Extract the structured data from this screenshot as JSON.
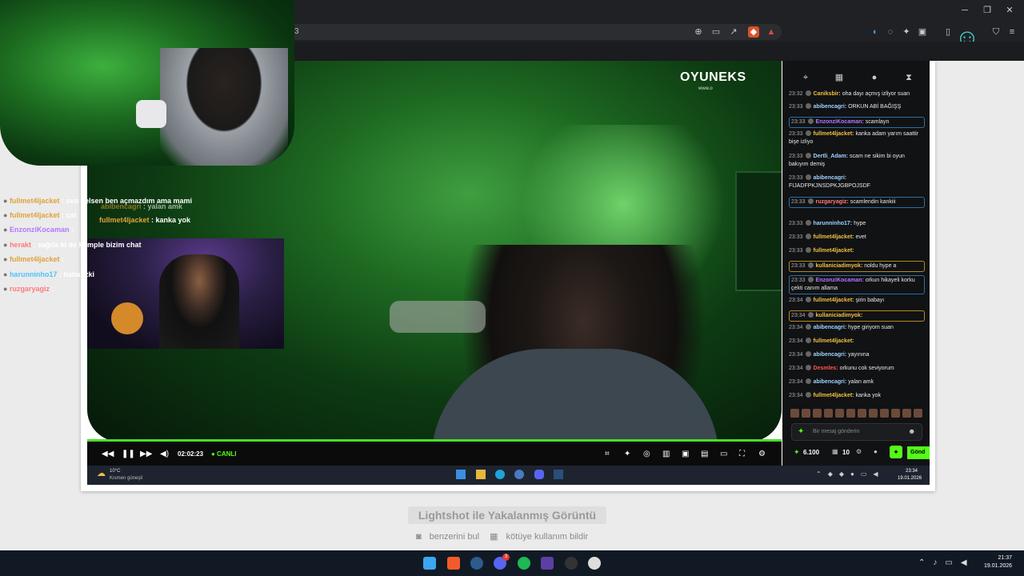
{
  "browser": {
    "url_fragment": "3",
    "controls": {
      "minimize": "─",
      "maximize": "❐",
      "close": "✕"
    }
  },
  "video": {
    "logo": "OYUNEKS",
    "logo_sub": "www.o",
    "time": "02:02:23",
    "live_label": "● CANLI"
  },
  "chat": {
    "messages": [
      {
        "time": "23:32",
        "user": "Caniksbir",
        "text": "oha dayı açmış izliyor suan",
        "style": ""
      },
      {
        "time": "23:33",
        "user": "abibencagri",
        "text": "ORKUN ABİ BAĞIŞŞ",
        "style": ""
      },
      {
        "time": "23:33",
        "user": "EnzonziKocaman",
        "text": "scamlayn",
        "style": "hl"
      },
      {
        "time": "23:33",
        "user": "fullmet4ljacket",
        "text": "kanka adam yarım saattir bişe izliyo",
        "style": ""
      },
      {
        "time": "23:33",
        "user": "Dertli_Adam",
        "text": "scam ne sikim bi oyun bakıyım demiş",
        "style": ""
      },
      {
        "time": "23:33",
        "user": "abibencagri",
        "text": "FIJADFPKJNSDPKJGBPOJSDF",
        "style": ""
      },
      {
        "time": "23:33",
        "user": "ruzgaryagiz",
        "text": "scamlendin kankiii",
        "style": "hl"
      },
      {
        "time": "23:33",
        "user": "harunninho17",
        "text": "hype",
        "style": ""
      },
      {
        "time": "23:33",
        "user": "fullmet4ljacket",
        "text": "evet",
        "style": ""
      },
      {
        "time": "23:33",
        "user": "fullmet4ljacket",
        "text": "",
        "style": ""
      },
      {
        "time": "23:33",
        "user": "kullaniciadimyok",
        "text": "noldu hype a",
        "style": "hlg"
      },
      {
        "time": "23:33",
        "user": "EnzonziKocaman",
        "text": "orkun hikayeli korku çekti canım allama",
        "style": "hl"
      },
      {
        "time": "23:34",
        "user": "fullmet4ljacket",
        "text": "şirin babayı",
        "style": ""
      },
      {
        "time": "23:34",
        "user": "kullaniciadimyok",
        "text": "",
        "style": "hlg"
      },
      {
        "time": "23:34",
        "user": "abibencagri",
        "text": "hype giriyom suan",
        "style": ""
      },
      {
        "time": "23:34",
        "user": "fullmet4ljacket",
        "text": "",
        "style": ""
      },
      {
        "time": "23:34",
        "user": "abibencagri",
        "text": "yayınına",
        "style": ""
      },
      {
        "time": "23:34",
        "user": "Desmles",
        "text": "orkunu cok seviyorum",
        "style": ""
      },
      {
        "time": "23:34",
        "user": "abibencagri",
        "text": "yalan amk",
        "style": ""
      },
      {
        "time": "23:34",
        "user": "fullmet4ljacket",
        "text": "kanka yok",
        "style": ""
      }
    ],
    "input_placeholder": "Bir mesaj gönderin",
    "points": "6.100",
    "viewers": "10",
    "send_label": "Gönd"
  },
  "overlay_chat": [
    {
      "user": "fullmet4ljacket",
      "text": "sen gelsen ben açmazdım ama mami"
    },
    {
      "user": "fullmet4ljacket",
      "text": "cat"
    },
    {
      "user": "EnzonziKocaman",
      "text": ""
    },
    {
      "user": "herakt",
      "text": "sağda ki de komple bizim chat"
    },
    {
      "user": "fullmet4ljacket",
      "text": ""
    },
    {
      "user": "harunninho17",
      "text": "hahahzki"
    },
    {
      "user": "ruzgaryagiz",
      "text": ""
    }
  ],
  "overlay_ghost": [
    {
      "user": "abibencagri",
      "text": "yalan amk"
    },
    {
      "user": "fullmet4ljacket",
      "text": "kanka yok"
    }
  ],
  "inner_taskbar": {
    "weather_temp": "10°C",
    "weather_desc": "Kısmen güneşli",
    "time": "23:34",
    "date": "19.01.2026"
  },
  "footer": {
    "caption": "Lightshot ile Yakalanmış Görüntü",
    "link_similar": "benzerini bul",
    "link_report": "kötüye kullanım bildir"
  },
  "taskbar": {
    "time": "21:37",
    "date": "19.01.2026",
    "discord_badge": "3"
  }
}
